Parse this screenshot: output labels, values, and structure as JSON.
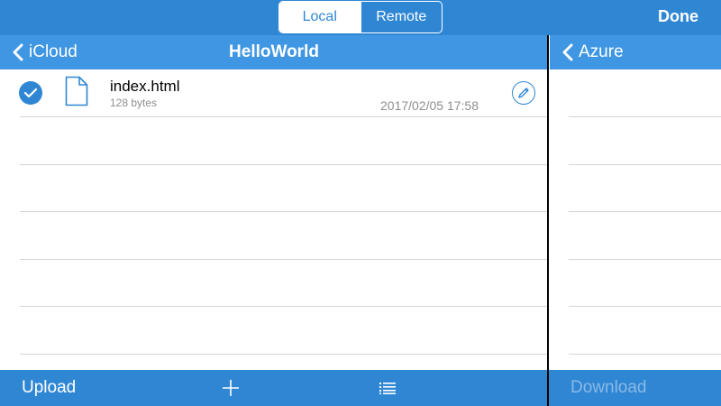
{
  "segmented": {
    "local": "Local",
    "remote": "Remote",
    "selected": "Local"
  },
  "topbar": {
    "done_label": "Done"
  },
  "left_pane": {
    "back_label": "iCloud",
    "title": "HelloWorld",
    "files": [
      {
        "name": "index.html",
        "size": "128 bytes",
        "modified": "2017/02/05 17:58",
        "selected": true
      }
    ],
    "toolbar": {
      "upload_label": "Upload",
      "add_icon": "plus-icon",
      "list_icon": "list-icon"
    }
  },
  "right_pane": {
    "back_label": "Azure",
    "toolbar": {
      "download_label": "Download",
      "download_enabled": false
    }
  },
  "colors": {
    "accent": "#2f87d4",
    "navbar": "#3f97e3",
    "separator": "#d4d4d4",
    "secondary_text": "#8e8e93"
  }
}
